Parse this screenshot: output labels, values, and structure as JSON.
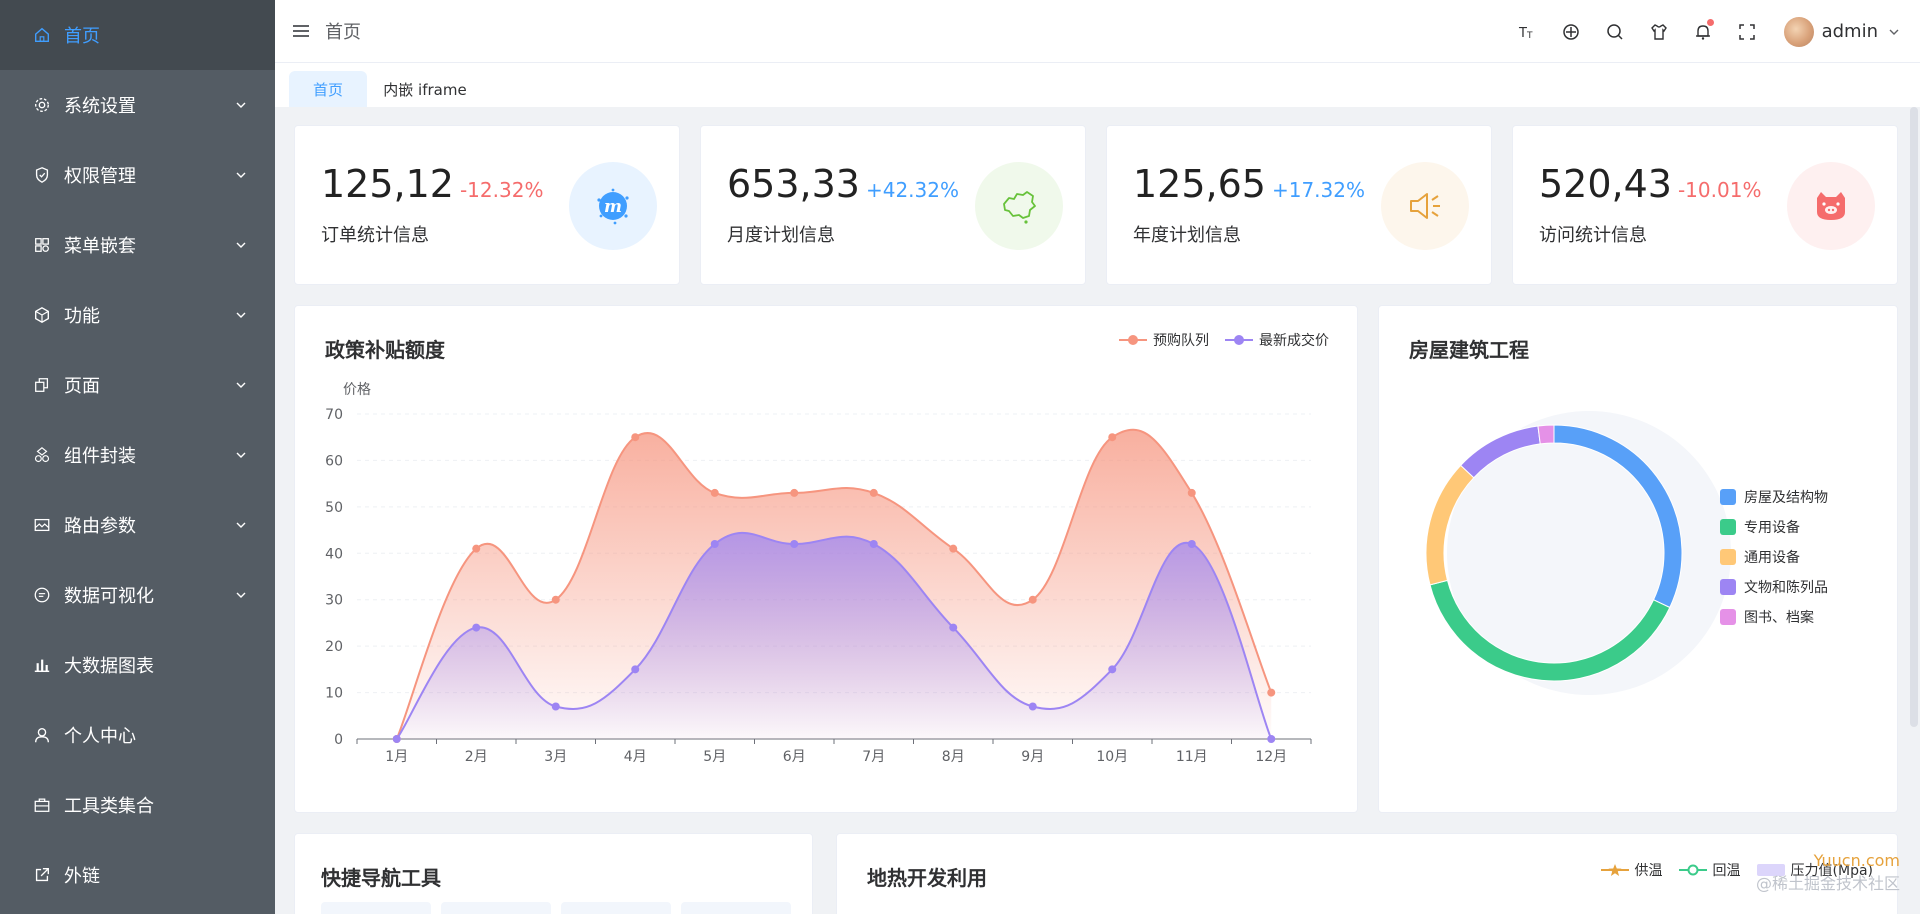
{
  "sidebar": {
    "items": [
      {
        "label": "首页",
        "icon": "home-icon",
        "active": true,
        "expandable": false
      },
      {
        "label": "系统设置",
        "icon": "gear-icon",
        "active": false,
        "expandable": true
      },
      {
        "label": "权限管理",
        "icon": "shield-icon",
        "active": false,
        "expandable": true
      },
      {
        "label": "菜单嵌套",
        "icon": "grid-icon",
        "active": false,
        "expandable": true
      },
      {
        "label": "功能",
        "icon": "box-icon",
        "active": false,
        "expandable": true
      },
      {
        "label": "页面",
        "icon": "copy-icon",
        "active": false,
        "expandable": true
      },
      {
        "label": "组件封装",
        "icon": "components-icon",
        "active": false,
        "expandable": true
      },
      {
        "label": "路由参数",
        "icon": "image-icon",
        "active": false,
        "expandable": true
      },
      {
        "label": "数据可视化",
        "icon": "chat-icon",
        "active": false,
        "expandable": true
      },
      {
        "label": "大数据图表",
        "icon": "bar-chart-icon",
        "active": false,
        "expandable": false
      },
      {
        "label": "个人中心",
        "icon": "user-icon",
        "active": false,
        "expandable": false
      },
      {
        "label": "工具类集合",
        "icon": "briefcase-icon",
        "active": false,
        "expandable": false
      },
      {
        "label": "外链",
        "icon": "external-link-icon",
        "active": false,
        "expandable": false
      }
    ]
  },
  "header": {
    "breadcrumb": "首页",
    "user": "admin",
    "icons": [
      "font-size-icon",
      "crosshair-icon",
      "search-icon",
      "shirt-icon",
      "bell-icon",
      "fullscreen-icon"
    ]
  },
  "tabs": [
    {
      "label": "首页",
      "active": true
    },
    {
      "label": "内嵌 iframe",
      "active": false
    }
  ],
  "stats": [
    {
      "value": "125,12",
      "change": "-12.32%",
      "label": "订单统计信息",
      "trend": "down",
      "icon": "meetup-icon",
      "color": "#409eff",
      "bg": "#e8f3ff"
    },
    {
      "value": "653,33",
      "change": "+42.32%",
      "label": "月度计划信息",
      "trend": "up",
      "icon": "china-map-icon",
      "color": "#67c23a",
      "bg": "#f0f9eb"
    },
    {
      "value": "125,65",
      "change": "+17.32%",
      "label": "年度计划信息",
      "trend": "up",
      "icon": "speaker-icon",
      "color": "#e6a23c",
      "bg": "#fdf6ec"
    },
    {
      "value": "520,43",
      "change": "-10.01%",
      "label": "访问统计信息",
      "trend": "down",
      "icon": "cat-icon",
      "color": "#f56c6c",
      "bg": "#fef0f0"
    }
  ],
  "colors": {
    "down": "#f56c6c",
    "up": "#409eff"
  },
  "line_card": {
    "title": "政策补贴额度"
  },
  "pie_card": {
    "title": "房屋建筑工程"
  },
  "quick_card": {
    "title": "快捷导航工具"
  },
  "geo_card": {
    "title": "地热开发利用",
    "legend": [
      "供温",
      "回温",
      "压力值(Mpa)"
    ]
  },
  "watermark": {
    "line1": "Yuucn.com",
    "line2": "@稀土掘金技术社区"
  },
  "chart_data": [
    {
      "type": "area",
      "title": "政策补贴额度",
      "ylabel": "价格",
      "categories": [
        "1月",
        "2月",
        "3月",
        "4月",
        "5月",
        "6月",
        "7月",
        "8月",
        "9月",
        "10月",
        "11月",
        "12月"
      ],
      "ylim": [
        0,
        70
      ],
      "yticks": [
        0,
        10,
        20,
        30,
        40,
        50,
        60,
        70
      ],
      "legend_position": "top-right",
      "series": [
        {
          "name": "预购队列",
          "color": "#f6957f",
          "values": [
            0,
            41,
            30,
            65,
            53,
            53,
            53,
            41,
            30,
            65,
            53,
            10
          ]
        },
        {
          "name": "最新成交价",
          "color": "#9d85f3",
          "values": [
            0,
            24,
            7,
            15,
            42,
            42,
            42,
            24,
            7,
            15,
            42,
            0
          ]
        }
      ]
    },
    {
      "type": "pie",
      "title": "房屋建筑工程",
      "legend_position": "right",
      "labels": [
        "房屋及结构物",
        "专用设备",
        "通用设备",
        "文物和陈列品",
        "图书、档案"
      ],
      "colors": [
        "#58a0f8",
        "#3bcb8a",
        "#ffc877",
        "#9d85f3",
        "#e591e7"
      ],
      "values": [
        32,
        39,
        16,
        11,
        2
      ]
    }
  ]
}
